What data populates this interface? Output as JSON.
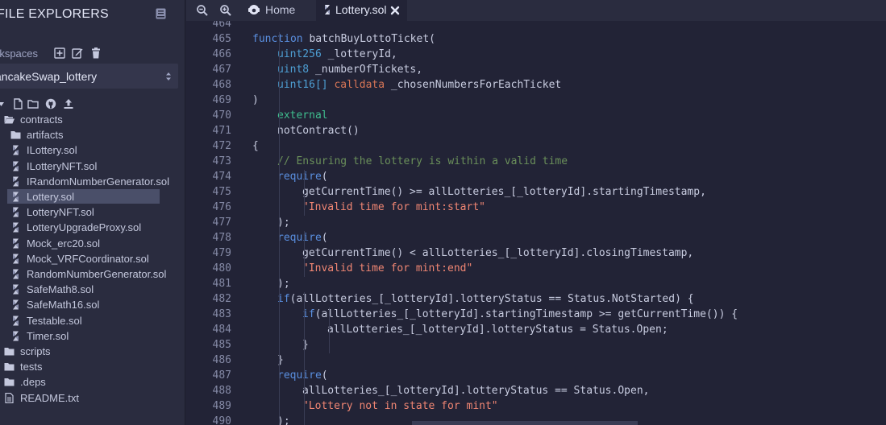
{
  "sidebar": {
    "title": "FILE EXPLORERS",
    "workspaces_label": "rkspaces",
    "workspace_selected": "ancakeSwap_lottery",
    "tree": [
      {
        "label": "contracts",
        "kind": "folder-open",
        "depth": 0
      },
      {
        "label": "artifacts",
        "kind": "folder",
        "depth": 1
      },
      {
        "label": "ILottery.sol",
        "kind": "sol",
        "depth": 1
      },
      {
        "label": "ILotteryNFT.sol",
        "kind": "sol",
        "depth": 1
      },
      {
        "label": "IRandomNumberGenerator.sol",
        "kind": "sol",
        "depth": 1
      },
      {
        "label": "Lottery.sol",
        "kind": "sol",
        "depth": 1,
        "active": true
      },
      {
        "label": "LotteryNFT.sol",
        "kind": "sol",
        "depth": 1
      },
      {
        "label": "LotteryUpgradeProxy.sol",
        "kind": "sol",
        "depth": 1
      },
      {
        "label": "Mock_erc20.sol",
        "kind": "sol",
        "depth": 1
      },
      {
        "label": "Mock_VRFCoordinator.sol",
        "kind": "sol",
        "depth": 1
      },
      {
        "label": "RandomNumberGenerator.sol",
        "kind": "sol",
        "depth": 1
      },
      {
        "label": "SafeMath8.sol",
        "kind": "sol",
        "depth": 1
      },
      {
        "label": "SafeMath16.sol",
        "kind": "sol",
        "depth": 1
      },
      {
        "label": "Testable.sol",
        "kind": "sol",
        "depth": 1
      },
      {
        "label": "Timer.sol",
        "kind": "sol",
        "depth": 1
      },
      {
        "label": "scripts",
        "kind": "folder",
        "depth": 0
      },
      {
        "label": "tests",
        "kind": "folder",
        "depth": 0
      },
      {
        "label": ".deps",
        "kind": "folder",
        "depth": 0
      },
      {
        "label": "README.txt",
        "kind": "file",
        "depth": 0
      }
    ]
  },
  "tabs": {
    "home": "Home",
    "lottery": "Lottery.sol"
  },
  "editor": {
    "lines": [
      {
        "n": "464",
        "indent": 0,
        "parts": []
      },
      {
        "n": "465",
        "indent": 1,
        "parts": [
          [
            "k",
            "function"
          ],
          [
            "p",
            " batchBuyLottoTicket("
          ]
        ]
      },
      {
        "n": "466",
        "indent": 2,
        "parts": [
          [
            "ty",
            "uint256"
          ],
          [
            "p",
            " _lotteryId,"
          ]
        ]
      },
      {
        "n": "467",
        "indent": 2,
        "parts": [
          [
            "ty",
            "uint8"
          ],
          [
            "p",
            " _numberOfTickets,"
          ]
        ]
      },
      {
        "n": "468",
        "indent": 2,
        "parts": [
          [
            "ty",
            "uint16[]"
          ],
          [
            "p",
            " "
          ],
          [
            "cd",
            "calldata"
          ],
          [
            "p",
            " _chosenNumbersForEachTicket"
          ]
        ]
      },
      {
        "n": "469",
        "indent": 1,
        "parts": [
          [
            "p",
            ")"
          ]
        ]
      },
      {
        "n": "470",
        "indent": 2,
        "parts": [
          [
            "ext",
            "external"
          ]
        ]
      },
      {
        "n": "471",
        "indent": 2,
        "parts": [
          [
            "p",
            "notContract()"
          ]
        ]
      },
      {
        "n": "472",
        "indent": 1,
        "parts": [
          [
            "p",
            "{"
          ]
        ]
      },
      {
        "n": "473",
        "indent": 2,
        "parts": [
          [
            "cmt",
            "// Ensuring the lottery is within a valid time"
          ]
        ]
      },
      {
        "n": "474",
        "indent": 2,
        "parts": [
          [
            "k",
            "require"
          ],
          [
            "p",
            "("
          ]
        ]
      },
      {
        "n": "475",
        "indent": 3,
        "parts": [
          [
            "p",
            "getCurrentTime() >= allLotteries_[_lotteryId].startingTimestamp,"
          ]
        ]
      },
      {
        "n": "476",
        "indent": 3,
        "parts": [
          [
            "str",
            "\"Invalid time for mint:start\""
          ]
        ]
      },
      {
        "n": "477",
        "indent": 2,
        "parts": [
          [
            "p",
            ");"
          ]
        ]
      },
      {
        "n": "478",
        "indent": 2,
        "parts": [
          [
            "k",
            "require"
          ],
          [
            "p",
            "("
          ]
        ]
      },
      {
        "n": "479",
        "indent": 3,
        "parts": [
          [
            "p",
            "getCurrentTime() < allLotteries_[_lotteryId].closingTimestamp,"
          ]
        ]
      },
      {
        "n": "480",
        "indent": 3,
        "parts": [
          [
            "str",
            "\"Invalid time for mint:end\""
          ]
        ]
      },
      {
        "n": "481",
        "indent": 2,
        "parts": [
          [
            "p",
            ");"
          ]
        ]
      },
      {
        "n": "482",
        "indent": 2,
        "parts": [
          [
            "k",
            "if"
          ],
          [
            "p",
            "(allLotteries_[_lotteryId].lotteryStatus == Status.NotStarted) {"
          ]
        ]
      },
      {
        "n": "483",
        "indent": 3,
        "parts": [
          [
            "k",
            "if"
          ],
          [
            "p",
            "(allLotteries_[_lotteryId].startingTimestamp >= getCurrentTime()) {"
          ]
        ]
      },
      {
        "n": "484",
        "indent": 4,
        "parts": [
          [
            "p",
            "allLotteries_[_lotteryId].lotteryStatus = Status.Open;"
          ]
        ]
      },
      {
        "n": "485",
        "indent": 3,
        "parts": [
          [
            "p",
            "}"
          ]
        ]
      },
      {
        "n": "486",
        "indent": 2,
        "parts": [
          [
            "p",
            "}"
          ]
        ]
      },
      {
        "n": "487",
        "indent": 2,
        "parts": [
          [
            "k",
            "require"
          ],
          [
            "p",
            "("
          ]
        ]
      },
      {
        "n": "488",
        "indent": 3,
        "parts": [
          [
            "p",
            "allLotteries_[_lotteryId].lotteryStatus == Status.Open,"
          ]
        ]
      },
      {
        "n": "489",
        "indent": 3,
        "parts": [
          [
            "str",
            "\"Lottery not in state for mint\""
          ]
        ]
      },
      {
        "n": "490",
        "indent": 2,
        "parts": [
          [
            "p",
            ");"
          ]
        ]
      }
    ]
  },
  "colors": {
    "bg": "#222336",
    "panel": "#2a2c3f",
    "keyword": "#5a8fe0",
    "string": "#f08673",
    "comment": "#6a8f5a",
    "external": "#3fbf8f"
  }
}
